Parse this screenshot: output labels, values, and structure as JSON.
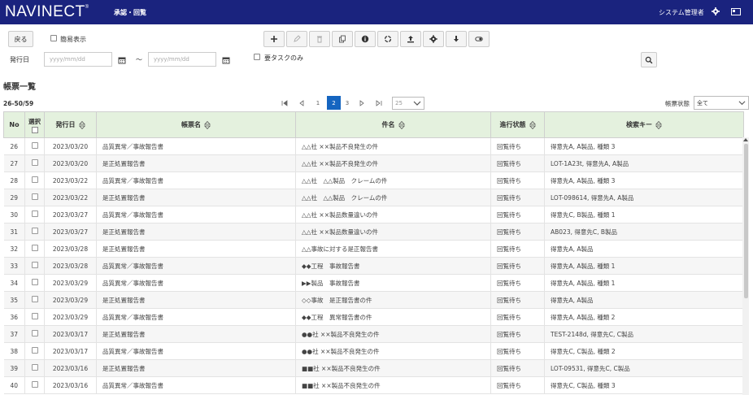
{
  "header": {
    "logo": "NAVINECT",
    "logo_mark": "®",
    "screen_title": "承認・回覧",
    "user": "システム管理者"
  },
  "toolbar": {
    "back_label": "戻る",
    "simple_view_label": "簡易表示",
    "issue_date_label": "発行日",
    "date_from_placeholder": "yyyy/mm/dd",
    "date_to_placeholder": "yyyy/mm/dd",
    "range_sep": "～",
    "my_tasks_label": "要タスクのみ",
    "tool_icons": [
      "plus-icon",
      "edit-icon",
      "delete-icon",
      "copy-icon",
      "info-icon",
      "recycle-icon",
      "upload-icon",
      "settings-icon",
      "download-icon",
      "toggle-icon"
    ]
  },
  "list": {
    "title": "帳票一覧",
    "count": "26-50/59",
    "pages": [
      "1",
      "2",
      "3"
    ],
    "current_page": "2",
    "page_size": "25",
    "status_label": "帳票状態",
    "status_value": "全て"
  },
  "table": {
    "columns": [
      "No",
      "選択",
      "発行日",
      "帳票名",
      "件名",
      "進行状態",
      "検索キー"
    ],
    "rows": [
      [
        "26",
        "2023/03/20",
        "品質異常／事故報告書",
        "△△社 ××製品不良発生の件",
        "回覧待ち",
        "得意先A, A製品, 種類 3"
      ],
      [
        "27",
        "2023/03/20",
        "是正処置報告書",
        "△△社 ××製品不良発生の件",
        "回覧待ち",
        "LOT-1A23t, 得意先A, A製品"
      ],
      [
        "28",
        "2023/03/22",
        "品質異常／事故報告書",
        "△△社　△△製品　クレームの件",
        "回覧待ち",
        "得意先A, A製品, 種類 3"
      ],
      [
        "29",
        "2023/03/22",
        "是正処置報告書",
        "△△社　△△製品　クレームの件",
        "回覧待ち",
        "LOT-098614, 得意先A, A製品"
      ],
      [
        "30",
        "2023/03/27",
        "品質異常／事故報告書",
        "△△社 ××製品数量違いの件",
        "回覧待ち",
        "得意先C, B製品, 種類 1"
      ],
      [
        "31",
        "2023/03/27",
        "是正処置報告書",
        "△△社 ××製品数量違いの件",
        "回覧待ち",
        "AB023, 得意先C, B製品"
      ],
      [
        "32",
        "2023/03/28",
        "是正処置報告書",
        "△△事故に対する是正報告書",
        "回覧待ち",
        "得意先A, A製品"
      ],
      [
        "33",
        "2023/03/28",
        "品質異常／事故報告書",
        "◆◆工程　事故報告書",
        "回覧待ち",
        "得意先A, A製品, 種類 1"
      ],
      [
        "34",
        "2023/03/29",
        "品質異常／事故報告書",
        "▶▶製品　事故報告書",
        "回覧待ち",
        "得意先A, A製品, 種類 1"
      ],
      [
        "35",
        "2023/03/29",
        "是正処置報告書",
        "◇◇事故　是正報告書の件",
        "回覧待ち",
        "得意先A, A製品"
      ],
      [
        "36",
        "2023/03/29",
        "品質異常／事故報告書",
        "◆◆工程　異常報告書の件",
        "回覧待ち",
        "得意先A, A製品, 種類 2"
      ],
      [
        "37",
        "2023/03/17",
        "是正処置報告書",
        "●●社 ××製品不良発生の件",
        "回覧待ち",
        "TEST-2148d, 得意先C, C製品"
      ],
      [
        "38",
        "2023/03/17",
        "品質異常／事故報告書",
        "●●社 ××製品不良発生の件",
        "回覧待ち",
        "得意先C, C製品, 種類 2"
      ],
      [
        "39",
        "2023/03/16",
        "是正処置報告書",
        "■■社 ××製品不良発生の件",
        "回覧待ち",
        "LOT-09531, 得意先C, C製品"
      ],
      [
        "40",
        "2023/03/16",
        "品質異常／事故報告書",
        "■■社 ××製品不良発生の件",
        "回覧待ち",
        "得意先C, C製品, 種類 3"
      ]
    ]
  },
  "colors": {
    "header_bg": "#1a237e",
    "table_header_bg": "#e4f1de",
    "accent": "#1565c0"
  }
}
